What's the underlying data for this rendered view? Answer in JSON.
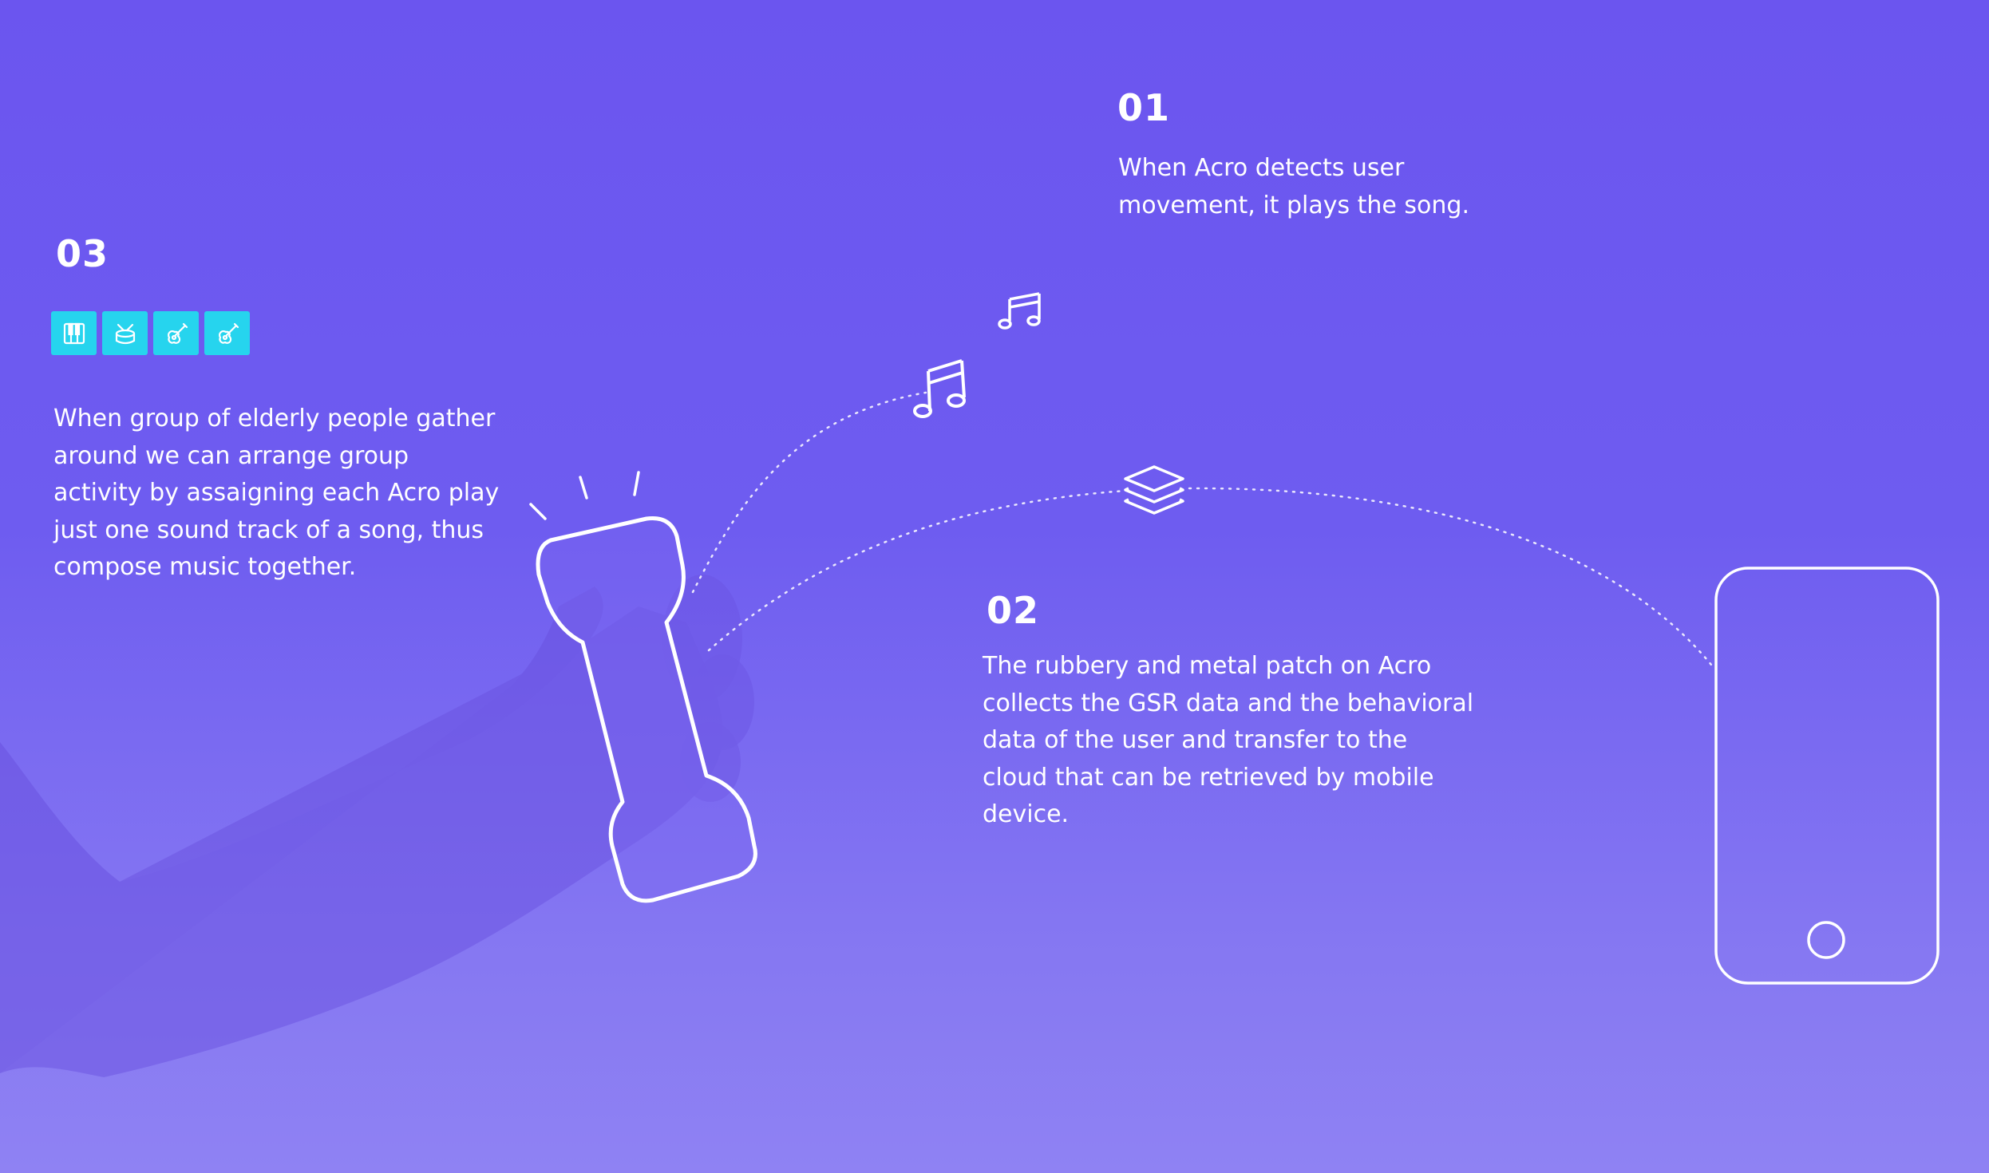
{
  "steps": [
    {
      "number": "01",
      "text": "When Acro detects user movement, it plays the song."
    },
    {
      "number": "02",
      "text": "The rubbery and metal patch on Acro collects the GSR data and the behavioral data of the user and transfer to the cloud that can be retrieved by mobile device."
    },
    {
      "number": "03",
      "text": "When group of elderly people gather around we can arrange group activity by assaigning each Acro play just one sound track of a song, thus compose music together."
    }
  ],
  "instruments": [
    {
      "icon": "piano-icon"
    },
    {
      "icon": "drum-icon"
    },
    {
      "icon": "guitar-icon"
    },
    {
      "icon": "guitar-icon"
    }
  ],
  "colors": {
    "background_top": "#6b55ef",
    "background_bottom": "#8f82f3",
    "instrument_tile": "#26d4ee",
    "line": "#ffffff"
  },
  "icons": [
    "music-note-icon",
    "layers-icon",
    "acro-device-icon",
    "smartphone-icon",
    "hand-silhouette"
  ]
}
